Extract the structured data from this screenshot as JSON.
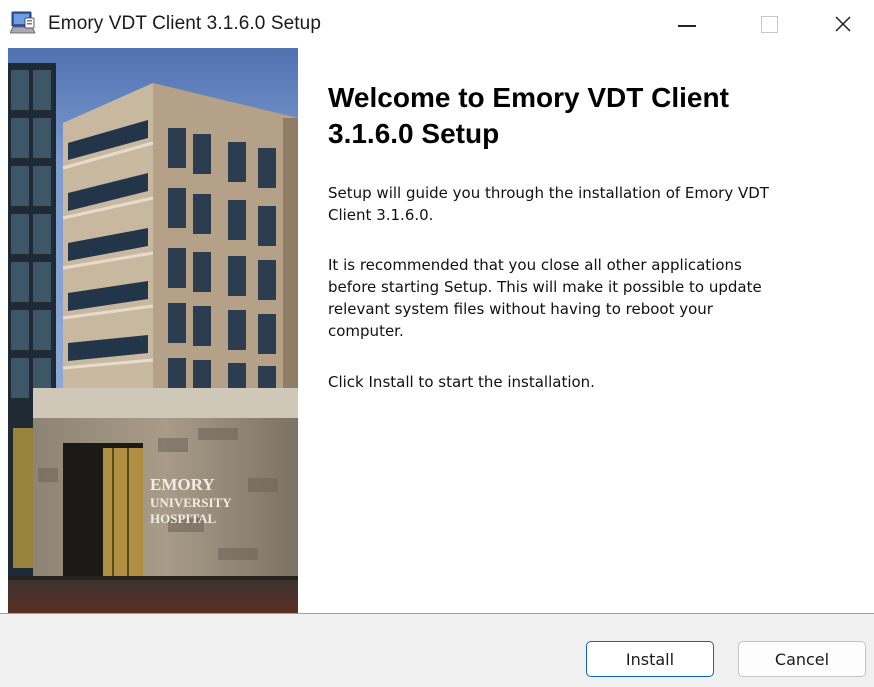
{
  "window": {
    "title": "Emory VDT Client 3.1.6.0 Setup"
  },
  "banner": {
    "sign_line1": "EMORY",
    "sign_line2": "UNIVERSITY",
    "sign_line3": "HOSPITAL"
  },
  "content": {
    "heading_line1": "Welcome to Emory VDT Client",
    "heading_line2": "3.1.6.0 Setup",
    "para1_line1": "Setup will guide you through the installation of Emory VDT",
    "para1_line2": "Client 3.1.6.0.",
    "para2_line1": "It is recommended that you close all other applications",
    "para2_line2": "before starting Setup. This will make it possible to update",
    "para2_line3": "relevant system files without having to reboot your",
    "para2_line4": "computer.",
    "para3": "Click Install to start the installation."
  },
  "buttons": {
    "install": "Install",
    "cancel": "Cancel"
  },
  "colors": {
    "accent": "#0b63c4",
    "footer_bg": "#f0f0f0"
  },
  "icons": {
    "app": "installer-computer-icon",
    "minimize": "minimize-icon",
    "maximize": "maximize-icon",
    "close": "close-icon"
  }
}
